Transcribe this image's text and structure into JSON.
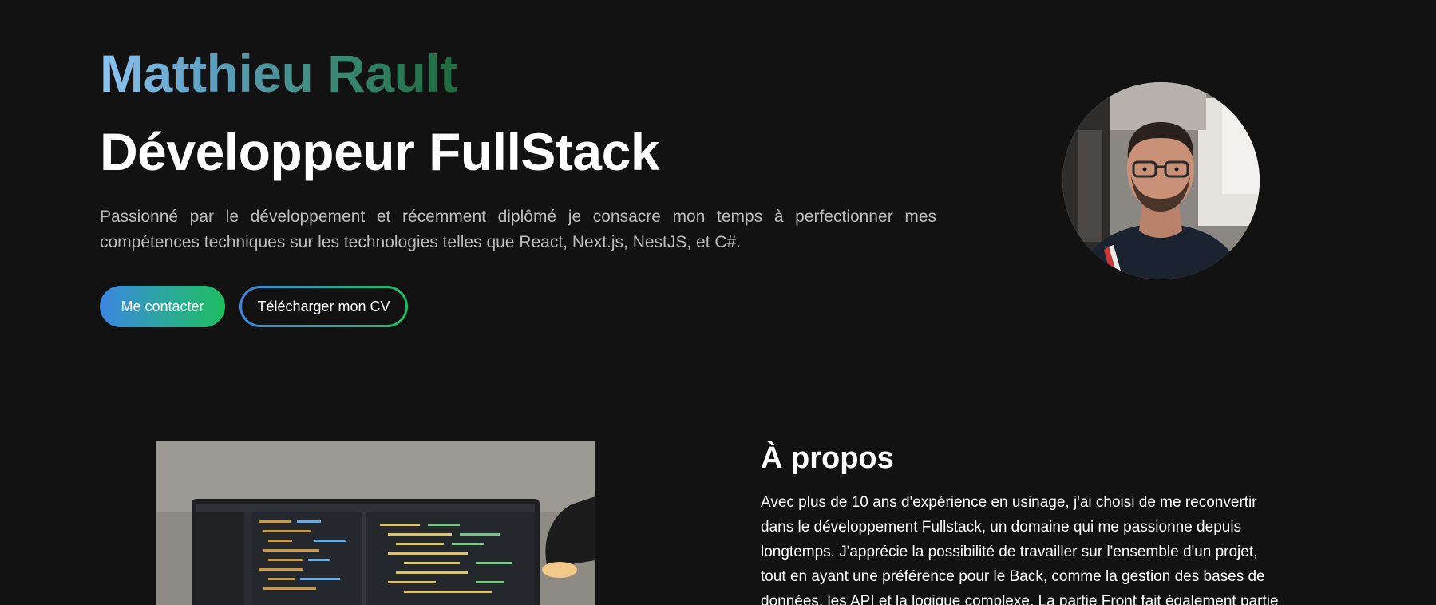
{
  "hero": {
    "name": "Matthieu Rault",
    "title": "Développeur FullStack",
    "description": "Passionné par le développement et récemment diplômé je consacre mon temps à perfectionner mes compétences techniques sur les technologies telles que React, Next.js, NestJS, et C#.",
    "contact_button": "Me contacter",
    "cv_button": "Télécharger mon CV",
    "colors": {
      "name_gradient_start": "#8dc4f2",
      "name_gradient_end": "#1d6b3d",
      "button_gradient_start": "#3d86e0",
      "button_gradient_end": "#1fbd60",
      "background": "#121212"
    }
  },
  "about": {
    "heading": "À propos",
    "lines": [
      "Avec plus de 10 ans d'expérience en usinage, j'ai choisi de me reconvertir",
      "dans le développement Fullstack, un domaine qui me passionne depuis",
      "longtemps. J'apprécie la possibilité de travailler sur l'ensemble d'un projet,",
      "tout en ayant une préférence pour le Back, comme la gestion des bases de",
      "données, les API et la logique complexe. La partie Front fait également partie"
    ]
  }
}
